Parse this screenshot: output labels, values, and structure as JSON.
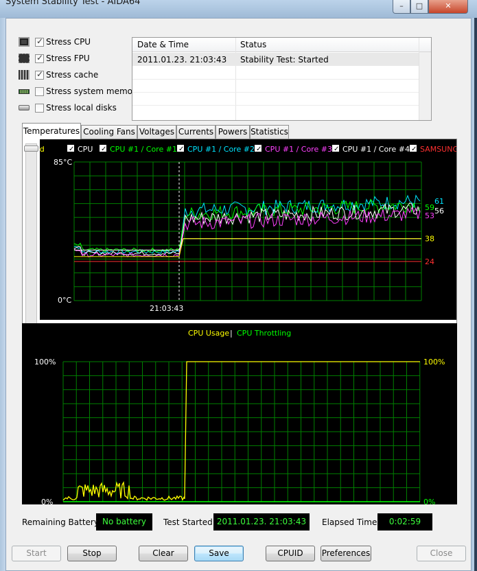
{
  "window": {
    "title": "System Stability Test - AIDA64",
    "minimize": "–",
    "maximize": "□",
    "close": "✕"
  },
  "stress_options": [
    {
      "label": "Stress CPU",
      "checked": true,
      "icon": "cpu-icon"
    },
    {
      "label": "Stress FPU",
      "checked": true,
      "icon": "fpu-icon"
    },
    {
      "label": "Stress cache",
      "checked": true,
      "icon": "cache-icon"
    },
    {
      "label": "Stress system memory",
      "checked": false,
      "icon": "memory-icon"
    },
    {
      "label": "Stress local disks",
      "checked": false,
      "icon": "disk-icon"
    }
  ],
  "status_list": {
    "columns": [
      "Date & Time",
      "Status"
    ],
    "rows": [
      {
        "datetime": "2011.01.23. 21:03:43",
        "status": "Stability Test: Started"
      }
    ]
  },
  "tabs": [
    {
      "label": "Temperatures",
      "active": true
    },
    {
      "label": "Cooling Fans",
      "active": false
    },
    {
      "label": "Voltages",
      "active": false
    },
    {
      "label": "Currents",
      "active": false
    },
    {
      "label": "Powers",
      "active": false
    },
    {
      "label": "Statistics",
      "active": false
    }
  ],
  "temperature_chart": {
    "legend": [
      {
        "label": "board",
        "color": "#ffff00",
        "checkbox": false
      },
      {
        "label": "CPU",
        "color": "#ffffff",
        "checkbox": true
      },
      {
        "label": "CPU #1 / Core #1",
        "color": "#00ff00",
        "checkbox": true
      },
      {
        "label": "CPU #1 / Core #2",
        "color": "#00e5ff",
        "checkbox": true
      },
      {
        "label": "CPU #1 / Core #3",
        "color": "#ff40ff",
        "checkbox": true
      },
      {
        "label": "CPU #1 / Core #4",
        "color": "#ffffff",
        "checkbox": true
      },
      {
        "label": "SAMSUNG",
        "color": "#ff3030",
        "checkbox": true
      }
    ],
    "y_max_label": "85°C",
    "y_min_label": "0°C",
    "marker_time": "21:03:43",
    "end_values": [
      {
        "text": "61",
        "color": "#00e5ff",
        "value": 61
      },
      {
        "text": "59",
        "color": "#00ff00",
        "value": 59
      },
      {
        "text": "56",
        "color": "#ffffff",
        "value": 56
      },
      {
        "text": "53",
        "color": "#ff40ff",
        "value": 53
      },
      {
        "text": "38",
        "color": "#ffff00",
        "value": 38
      },
      {
        "text": "24",
        "color": "#ff3030",
        "value": 24
      }
    ]
  },
  "usage_chart": {
    "legend": [
      {
        "label": "CPU Usage",
        "color": "#ffff00"
      },
      {
        "label": "|",
        "color": "#ffffff"
      },
      {
        "label": "CPU Throttling",
        "color": "#00ff00"
      }
    ],
    "left_top_label": "100%",
    "left_bottom_label": "0%",
    "right_top_label": "100%",
    "right_bottom_label": "0%"
  },
  "info": {
    "battery_label": "Remaining Battery:",
    "battery_value": "No battery",
    "started_label": "Test Started:",
    "started_value": "2011.01.23. 21:03:43",
    "elapsed_label": "Elapsed Time:",
    "elapsed_value": "0:02:59"
  },
  "buttons": {
    "start": "Start",
    "stop": "Stop",
    "clear": "Clear",
    "save": "Save",
    "cpuid": "CPUID",
    "preferences": "Preferences",
    "close": "Close"
  },
  "colors": {
    "grid": "#008000",
    "cpu_usage": "#ffff00",
    "cpu_throttling": "#00ff00",
    "info_text": "#3cff3c",
    "chart_bg": "#000000"
  }
}
